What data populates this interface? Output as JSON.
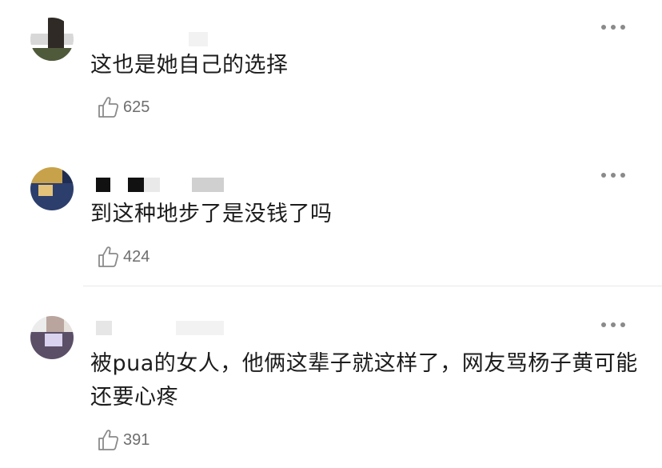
{
  "comments": [
    {
      "text": "这也是她自己的选择",
      "likes": "625"
    },
    {
      "text": "到这种地步了是没钱了吗",
      "likes": "424"
    },
    {
      "text": "被pua的女人，他俩这辈子就这样了，网友骂杨子黄可能还要心疼",
      "likes": "391"
    }
  ],
  "icons": {
    "like": "thumbs-up-icon",
    "more": "more-options-icon"
  },
  "colors": {
    "text": "#1c1c1c",
    "count": "#6e6e6e",
    "icon": "#8a8a8a",
    "divider": "#e8e8e8"
  }
}
